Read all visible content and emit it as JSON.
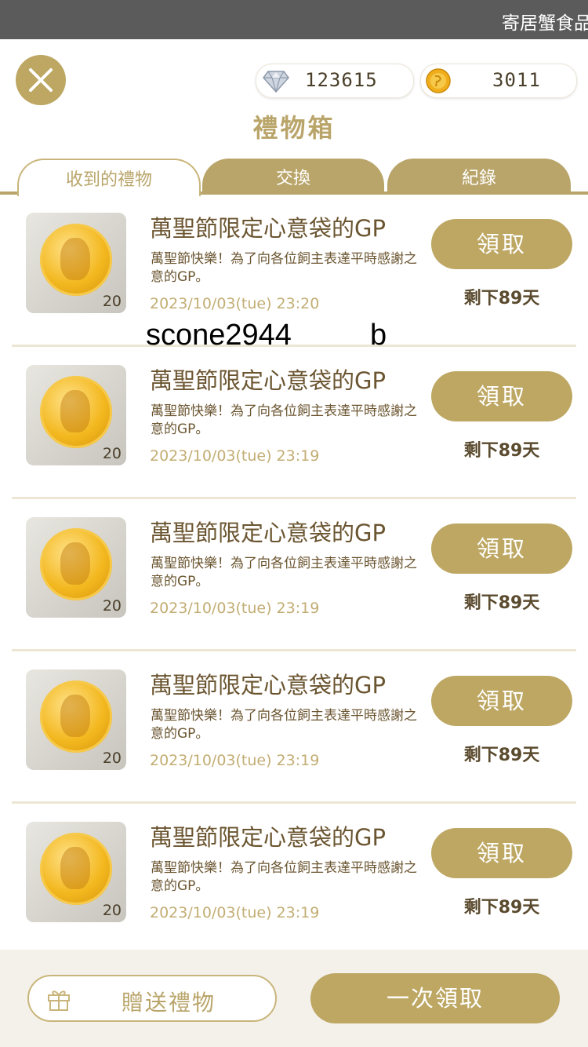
{
  "status_bar": {
    "marquee_text": "寄居蟹食品"
  },
  "header": {
    "title": "禮物箱",
    "diamond_balance": "123615",
    "coin_balance": "3011"
  },
  "tabs": [
    {
      "label": "收到的禮物",
      "active": true
    },
    {
      "label": "交換",
      "active": false
    },
    {
      "label": "紀錄",
      "active": false
    }
  ],
  "gifts": [
    {
      "title": "萬聖節限定心意袋的GP",
      "description": "萬聖節快樂！為了向各位飼主表達平時感謝之意的GP。",
      "date": "2023/10/03(tue) 23:20",
      "count": "20",
      "claim_label": "領取",
      "remaining": "剩下89天"
    },
    {
      "title": "萬聖節限定心意袋的GP",
      "description": "萬聖節快樂！為了向各位飼主表達平時感謝之意的GP。",
      "date": "2023/10/03(tue) 23:19",
      "count": "20",
      "claim_label": "領取",
      "remaining": "剩下89天"
    },
    {
      "title": "萬聖節限定心意袋的GP",
      "description": "萬聖節快樂！為了向各位飼主表達平時感謝之意的GP。",
      "date": "2023/10/03(tue) 23:19",
      "count": "20",
      "claim_label": "領取",
      "remaining": "剩下89天"
    },
    {
      "title": "萬聖節限定心意袋的GP",
      "description": "萬聖節快樂！為了向各位飼主表達平時感謝之意的GP。",
      "date": "2023/10/03(tue) 23:19",
      "count": "20",
      "claim_label": "領取",
      "remaining": "剩下89天"
    },
    {
      "title": "萬聖節限定心意袋的GP",
      "description": "萬聖節快樂！為了向各位飼主表達平時感謝之意的GP。",
      "date": "2023/10/03(tue) 23:19",
      "count": "20",
      "claim_label": "領取",
      "remaining": "剩下89天"
    }
  ],
  "overlay": {
    "username": "scone2944",
    "suffix": "b"
  },
  "footer": {
    "send_gift_label": "贈送禮物",
    "claim_all_label": "一次領取"
  },
  "colors": {
    "accent": "#bda763",
    "text": "#6b5530",
    "date": "#c2ad73"
  }
}
